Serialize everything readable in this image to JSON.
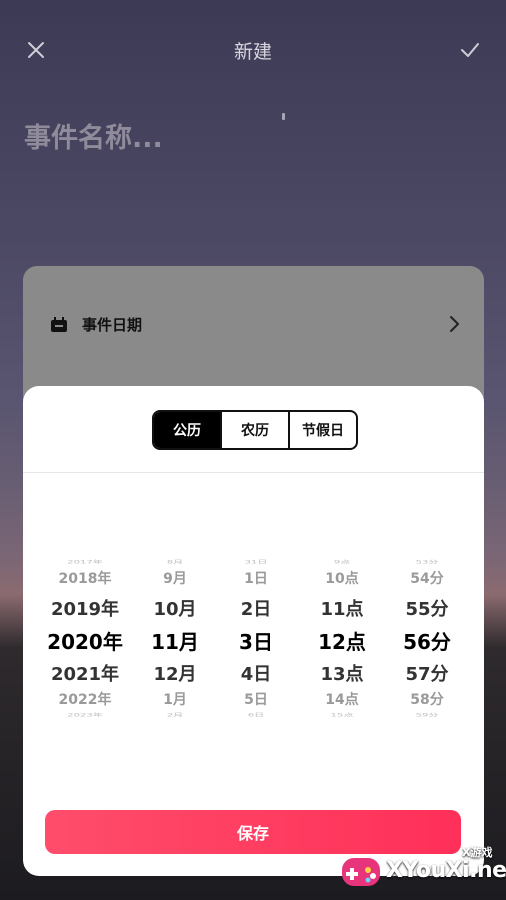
{
  "header": {
    "title": "新建",
    "close_icon": "close-icon",
    "confirm_icon": "check-icon"
  },
  "event": {
    "name_placeholder": "事件名称..."
  },
  "date_card": {
    "label": "事件日期",
    "icon": "calendar-icon",
    "chevron_icon": "chevron-right-icon"
  },
  "calendar_tabs": [
    "公历",
    "农历",
    "节假日"
  ],
  "picker": {
    "years": [
      "2017年",
      "2018年",
      "2019年",
      "2020年",
      "2021年",
      "2022年",
      "2023年"
    ],
    "months": [
      "8月",
      "9月",
      "10月",
      "11月",
      "12月",
      "1月",
      "2月"
    ],
    "days": [
      "31日",
      "1日",
      "2日",
      "3日",
      "4日",
      "5日",
      "6日"
    ],
    "hours": [
      "9点",
      "10点",
      "11点",
      "12点",
      "13点",
      "14点",
      "15点"
    ],
    "minutes": [
      "53分",
      "54分",
      "55分",
      "56分",
      "57分",
      "58分",
      "59分"
    ]
  },
  "save_label": "保存",
  "watermark": {
    "brand": "XYouXi.net",
    "tag": "X游戏"
  },
  "colors": {
    "accent": "#ff3a60",
    "selected_tab": "#000000"
  }
}
